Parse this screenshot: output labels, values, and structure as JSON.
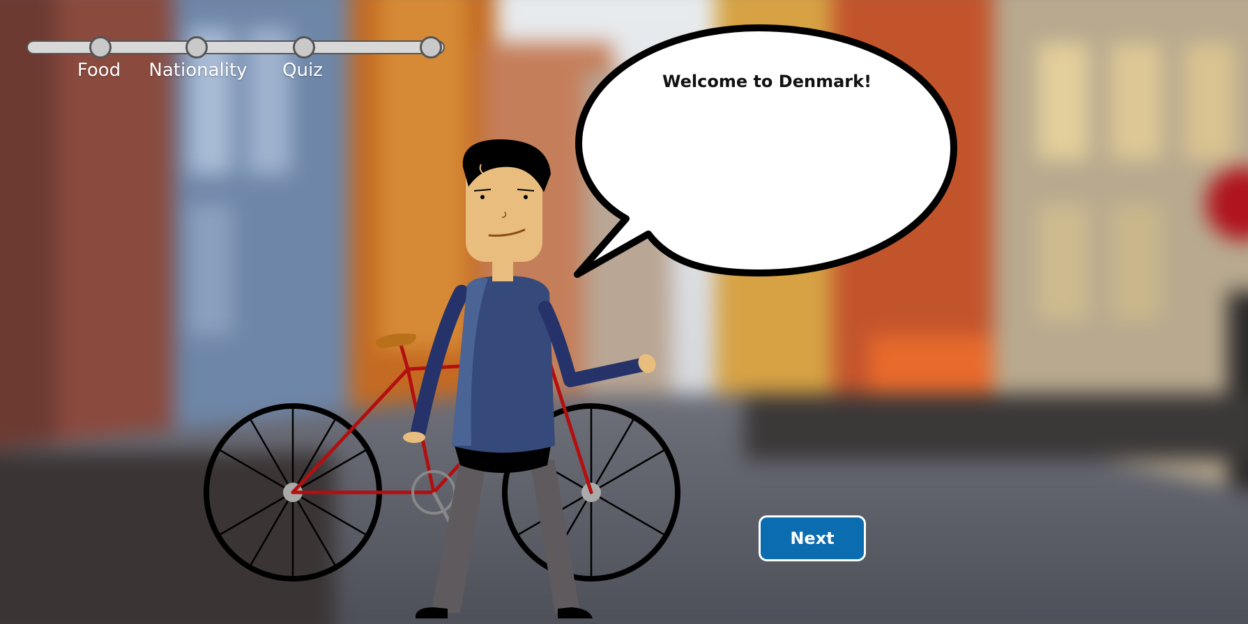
{
  "progress": {
    "steps": [
      {
        "label": "Food"
      },
      {
        "label": "Nationality"
      },
      {
        "label": "Quiz"
      },
      {
        "label": ""
      }
    ]
  },
  "speech_bubble": {
    "text": "Welcome to Denmark!"
  },
  "next_button": {
    "label": "Next"
  },
  "colors": {
    "button": "#0b6cb0",
    "sweater": "#354a7a",
    "bike_frame": "#b30f0f",
    "skin": "#e8bd7e"
  }
}
